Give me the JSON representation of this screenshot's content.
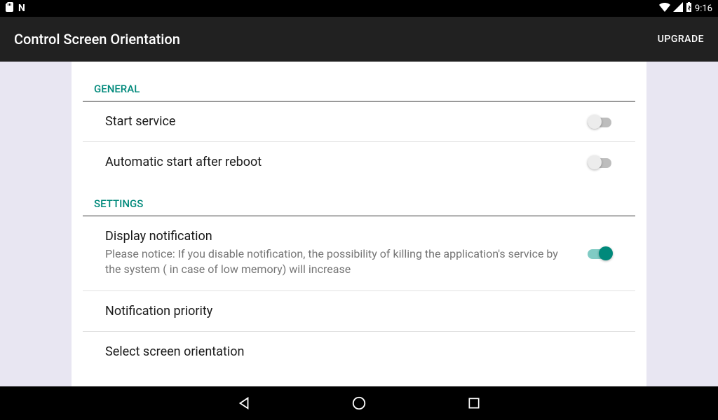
{
  "status": {
    "time": "9:16"
  },
  "appbar": {
    "title": "Control Screen Orientation",
    "upgrade": "UPGRADE"
  },
  "sections": {
    "general": {
      "header": "GENERAL",
      "start_service": "Start service",
      "auto_start": "Automatic start after reboot"
    },
    "settings": {
      "header": "SETTINGS",
      "display_notif": "Display notification",
      "display_notif_sub": "Please notice: If you disable notification, the possibility of killing the application's service by the system ( in case of low memory) will increase",
      "notif_priority": "Notification priority",
      "select_orient": "Select screen orientation"
    }
  }
}
